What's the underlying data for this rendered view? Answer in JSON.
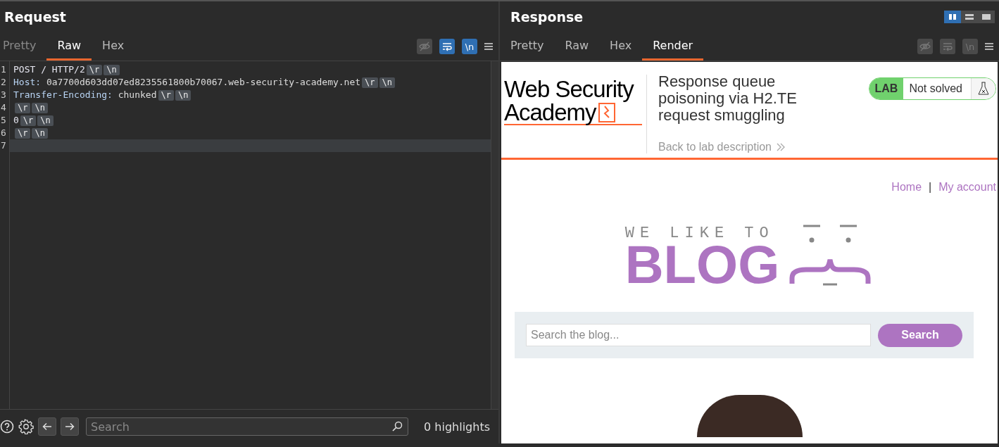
{
  "request": {
    "title": "Request",
    "tabs": [
      {
        "label": "Pretty",
        "selected": false
      },
      {
        "label": "Raw",
        "selected": true
      },
      {
        "label": "Hex",
        "selected": false
      }
    ],
    "tools": [
      {
        "kind": "eye",
        "on": false
      },
      {
        "kind": "wrap",
        "on": true
      },
      {
        "kind": "newline",
        "label": "\\n",
        "on": true
      },
      {
        "kind": "menu"
      }
    ],
    "lines": [
      {
        "number": "1",
        "parts": [
          {
            "kind": "text",
            "text": "POST / HTTP/2"
          },
          {
            "kind": "escape",
            "text": "\\r"
          },
          {
            "kind": "escape",
            "text": "\\n"
          }
        ]
      },
      {
        "number": "2",
        "parts": [
          {
            "kind": "name",
            "text": "Host:"
          },
          {
            "kind": "value",
            "text": " 0a7700d603dd07ed8235561800b70067.web-security-academy.net"
          },
          {
            "kind": "escape",
            "text": "\\r"
          },
          {
            "kind": "escape",
            "text": "\\n"
          }
        ]
      },
      {
        "number": "3",
        "parts": [
          {
            "kind": "name",
            "text": "Transfer-Encoding:"
          },
          {
            "kind": "value",
            "text": " chunked"
          },
          {
            "kind": "escape",
            "text": "\\r"
          },
          {
            "kind": "escape",
            "text": "\\n"
          }
        ]
      },
      {
        "number": "4",
        "parts": [
          {
            "kind": "escape",
            "text": "\\r"
          },
          {
            "kind": "escape",
            "text": "\\n"
          }
        ]
      },
      {
        "number": "5",
        "parts": [
          {
            "kind": "text",
            "text": "0"
          },
          {
            "kind": "escape",
            "text": "\\r"
          },
          {
            "kind": "escape",
            "text": "\\n"
          }
        ]
      },
      {
        "number": "6",
        "parts": [
          {
            "kind": "escape",
            "text": "\\r"
          },
          {
            "kind": "escape",
            "text": "\\n"
          }
        ]
      }
    ],
    "cursor_line": {
      "number": "7"
    },
    "search": {
      "placeholder": "Search"
    },
    "highlights": "0 highlights"
  },
  "response": {
    "title": "Response",
    "layouts": [
      {
        "kind": "columns",
        "selected": true
      },
      {
        "kind": "rows",
        "selected": false
      },
      {
        "kind": "single",
        "selected": false
      }
    ],
    "tabs": [
      {
        "label": "Pretty",
        "selected": false
      },
      {
        "label": "Raw",
        "selected": false
      },
      {
        "label": "Hex",
        "selected": false
      },
      {
        "label": "Render",
        "selected": true
      }
    ],
    "tools": [
      {
        "kind": "eye",
        "on": false
      },
      {
        "kind": "wrap",
        "on": false
      },
      {
        "kind": "newline",
        "label": "\\n",
        "on": false
      },
      {
        "kind": "menu"
      }
    ],
    "page": {
      "logo": [
        "Web Security",
        "Academy"
      ],
      "lab_title": "Response queue poisoning via H2.TE request smuggling",
      "back_link": "Back to lab description",
      "lab_badge": "LAB",
      "lab_status": "Not solved",
      "solved": false,
      "nav": [
        {
          "label": "Home"
        },
        {
          "label": "My account"
        }
      ],
      "nav_separator": "|",
      "blog_tagline": "WE LIKE TO",
      "blog_title": "BLOG",
      "search": {
        "placeholder": "Search the blog...",
        "button": "Search"
      }
    }
  }
}
